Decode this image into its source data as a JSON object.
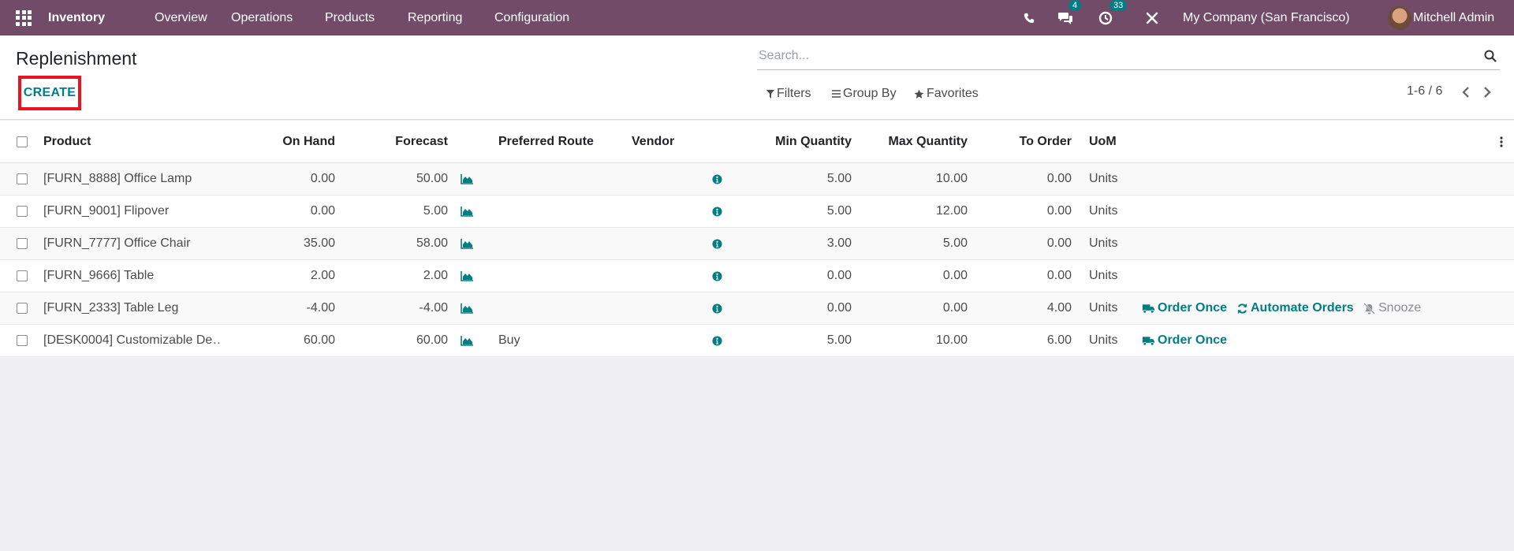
{
  "navbar": {
    "app_name": "Inventory",
    "menu": [
      "Overview",
      "Operations",
      "Products",
      "Reporting",
      "Configuration"
    ],
    "messages_count": "4",
    "activities_count": "33",
    "company": "My Company (San Francisco)",
    "user": "Mitchell Admin"
  },
  "control_panel": {
    "title": "Replenishment",
    "create_label": "CREATE",
    "search_placeholder": "Search...",
    "filters_label": "Filters",
    "groupby_label": "Group By",
    "favorites_label": "Favorites",
    "pager": "1-6 / 6"
  },
  "table": {
    "headers": {
      "product": "Product",
      "on_hand": "On Hand",
      "forecast": "Forecast",
      "preferred_route": "Preferred Route",
      "vendor": "Vendor",
      "min_qty": "Min Quantity",
      "max_qty": "Max Quantity",
      "to_order": "To Order",
      "uom": "UoM"
    },
    "rows": [
      {
        "product": "[FURN_8888] Office Lamp",
        "on_hand": "0.00",
        "forecast": "50.00",
        "route": "",
        "vendor": "",
        "min": "5.00",
        "max": "10.00",
        "to_order": "0.00",
        "uom": "Units"
      },
      {
        "product": "[FURN_9001] Flipover",
        "on_hand": "0.00",
        "forecast": "5.00",
        "route": "",
        "vendor": "",
        "min": "5.00",
        "max": "12.00",
        "to_order": "0.00",
        "uom": "Units"
      },
      {
        "product": "[FURN_7777] Office Chair",
        "on_hand": "35.00",
        "forecast": "58.00",
        "route": "",
        "vendor": "",
        "min": "3.00",
        "max": "5.00",
        "to_order": "0.00",
        "uom": "Units"
      },
      {
        "product": "[FURN_9666] Table",
        "on_hand": "2.00",
        "forecast": "2.00",
        "route": "",
        "vendor": "",
        "min": "0.00",
        "max": "0.00",
        "to_order": "0.00",
        "uom": "Units"
      },
      {
        "product": "[FURN_2333] Table Leg",
        "on_hand": "-4.00",
        "forecast": "-4.00",
        "route": "",
        "vendor": "",
        "min": "0.00",
        "max": "0.00",
        "to_order": "4.00",
        "uom": "Units",
        "order_once": "Order Once",
        "automate": "Automate Orders",
        "snooze": "Snooze"
      },
      {
        "product": "[DESK0004] Customizable De…",
        "on_hand": "60.00",
        "forecast": "60.00",
        "route": "Buy",
        "vendor": "",
        "min": "5.00",
        "max": "10.00",
        "to_order": "6.00",
        "uom": "Units",
        "order_once": "Order Once"
      }
    ]
  },
  "icons": {
    "graph": "area-chart-icon",
    "info": "info-circle-icon",
    "truck": "truck-icon",
    "refresh": "refresh-icon",
    "snooze": "bell-slash-icon"
  },
  "colors": {
    "navbar": "#714b67",
    "accent": "#017e84",
    "highlight_border": "#e8141f"
  }
}
